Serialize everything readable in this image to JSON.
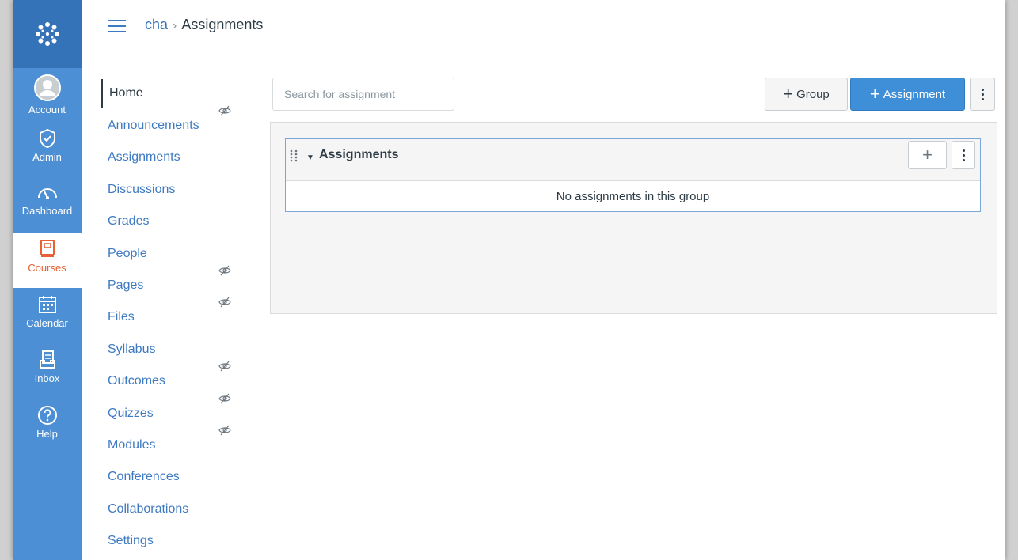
{
  "global_nav": {
    "items": [
      {
        "label": "Account",
        "icon": "avatar-icon"
      },
      {
        "label": "Admin",
        "icon": "shield-icon"
      },
      {
        "label": "Dashboard",
        "icon": "speedometer-icon"
      },
      {
        "label": "Courses",
        "icon": "book-icon",
        "active": true
      },
      {
        "label": "Calendar",
        "icon": "calendar-icon"
      },
      {
        "label": "Inbox",
        "icon": "inbox-icon"
      },
      {
        "label": "Help",
        "icon": "help-icon"
      }
    ],
    "colors": {
      "background": "#4d8fd4",
      "logo_bg": "#3473b7",
      "active_text": "#e66135"
    }
  },
  "header": {
    "breadcrumb_course": "cha",
    "breadcrumb_separator": "›",
    "breadcrumb_page": "Assignments"
  },
  "course_nav": {
    "home": "Home",
    "links": [
      {
        "label": "Announcements",
        "hidden": true
      },
      {
        "label": "Assignments",
        "hidden": false
      },
      {
        "label": "Discussions",
        "hidden": false
      },
      {
        "label": "Grades",
        "hidden": false
      },
      {
        "label": "People",
        "hidden": false
      },
      {
        "label": "Pages",
        "hidden": true
      },
      {
        "label": "Files",
        "hidden": true
      },
      {
        "label": "Syllabus",
        "hidden": false
      },
      {
        "label": "Outcomes",
        "hidden": true
      },
      {
        "label": "Quizzes",
        "hidden": true
      },
      {
        "label": "Modules",
        "hidden": true
      },
      {
        "label": "Conferences",
        "hidden": false
      },
      {
        "label": "Collaborations",
        "hidden": false
      },
      {
        "label": "Settings",
        "hidden": false
      }
    ]
  },
  "toolbar": {
    "search_placeholder": "Search for assignment",
    "group_button": "Group",
    "assignment_button": "Assignment"
  },
  "assignment_group": {
    "title": "Assignments",
    "empty_message": "No assignments in this group"
  }
}
